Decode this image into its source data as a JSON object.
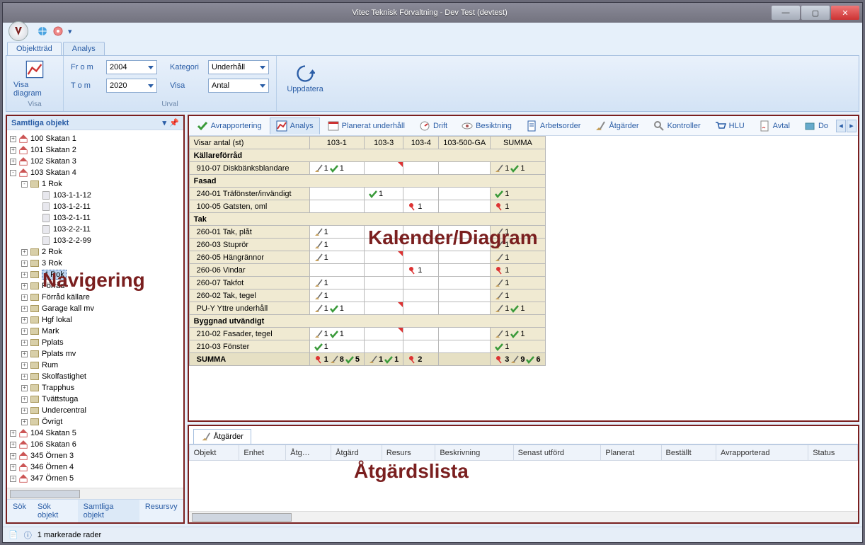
{
  "window": {
    "title": "Vitec Teknisk Förvaltning - Dev Test (devtest)"
  },
  "ribbon": {
    "tabs": {
      "objecttree": "Objektträd",
      "analys": "Analys"
    },
    "visa_diagram": "Visa diagram",
    "from_lbl": "Fr o m",
    "from_val": "2004",
    "to_lbl": "T o m",
    "to_val": "2020",
    "kategori_lbl": "Kategori",
    "kategori_val": "Underhåll",
    "visa_lbl": "Visa",
    "visa_val": "Antal",
    "uppdatera": "Uppdatera",
    "grp_visa": "Visa",
    "grp_urval": "Urval"
  },
  "nav": {
    "title": "Samtliga objekt",
    "items": [
      {
        "label": "100 Skatan 1",
        "icon": "house",
        "exp": "+"
      },
      {
        "label": "101 Skatan 2",
        "icon": "house",
        "exp": "+"
      },
      {
        "label": "102 Skatan 3",
        "icon": "house",
        "exp": "+"
      },
      {
        "label": "103 Skatan 4",
        "icon": "house",
        "exp": "-",
        "children": [
          {
            "label": "1 Rok",
            "icon": "folder",
            "exp": "-",
            "children": [
              {
                "label": "103-1-1-12",
                "icon": "leaf"
              },
              {
                "label": "103-1-2-11",
                "icon": "leaf"
              },
              {
                "label": "103-2-1-11",
                "icon": "leaf"
              },
              {
                "label": "103-2-2-11",
                "icon": "leaf"
              },
              {
                "label": "103-2-2-99",
                "icon": "leaf"
              }
            ]
          },
          {
            "label": "2 Rok",
            "icon": "folder",
            "exp": "+"
          },
          {
            "label": "3 Rok",
            "icon": "folder",
            "exp": "+"
          },
          {
            "label": "4 Rok",
            "icon": "folder",
            "exp": "+",
            "selected": true
          },
          {
            "label": "Förråd",
            "icon": "folder",
            "exp": "+"
          },
          {
            "label": "Förråd källare",
            "icon": "folder",
            "exp": "+"
          },
          {
            "label": "Garage kall mv",
            "icon": "folder",
            "exp": "+"
          },
          {
            "label": "Hgf lokal",
            "icon": "folder",
            "exp": "+"
          },
          {
            "label": "Mark",
            "icon": "folder",
            "exp": "+"
          },
          {
            "label": "Pplats",
            "icon": "folder",
            "exp": "+"
          },
          {
            "label": "Pplats mv",
            "icon": "folder",
            "exp": "+"
          },
          {
            "label": "Rum",
            "icon": "folder",
            "exp": "+"
          },
          {
            "label": "Skolfastighet",
            "icon": "folder",
            "exp": "+"
          },
          {
            "label": "Trapphus",
            "icon": "folder",
            "exp": "+"
          },
          {
            "label": "Tvättstuga",
            "icon": "folder",
            "exp": "+"
          },
          {
            "label": "Undercentral",
            "icon": "folder",
            "exp": "+"
          },
          {
            "label": "Övrigt",
            "icon": "folder",
            "exp": "+"
          }
        ]
      },
      {
        "label": "104 Skatan 5",
        "icon": "house",
        "exp": "+"
      },
      {
        "label": "106 Skatan 6",
        "icon": "house",
        "exp": "+"
      },
      {
        "label": "345 Örnen 3",
        "icon": "house",
        "exp": "+"
      },
      {
        "label": "346 Örnen 4",
        "icon": "house",
        "exp": "+"
      },
      {
        "label": "347 Örnen 5",
        "icon": "house",
        "exp": "+"
      }
    ],
    "bottom_tabs": {
      "sok": "Sök",
      "sokobj": "Sök objekt",
      "samtliga": "Samtliga objekt",
      "resursvy": "Resursvy"
    }
  },
  "tabs": {
    "avrapp": "Avrapportering",
    "analys": "Analys",
    "planerat": "Planerat underhåll",
    "drift": "Drift",
    "besikt": "Besiktning",
    "arbets": "Arbetsorder",
    "atgard": "Åtgärder",
    "kontroll": "Kontroller",
    "hlu": "HLU",
    "avtal": "Avtal",
    "dok": "Do"
  },
  "grid": {
    "corner": "Visar antal (st)",
    "cols": [
      "103-1",
      "103-3",
      "103-4",
      "103-500-GA",
      "SUMMA"
    ],
    "groups": [
      {
        "name": "Källareförråd",
        "rows": [
          {
            "name": "910-07 Diskbänksblandare",
            "cells": [
              "b1c1",
              "",
              "",
              "",
              "b1c1"
            ],
            "flag": [
              false,
              true,
              false,
              false,
              false
            ]
          }
        ]
      },
      {
        "name": "Fasad",
        "rows": [
          {
            "name": "240-01 Träfönster/invändigt",
            "cells": [
              "",
              "c1",
              "",
              "",
              "c1"
            ]
          },
          {
            "name": "100-05 Gatsten, oml",
            "cells": [
              "",
              "",
              "p1",
              "",
              "p1"
            ]
          }
        ]
      },
      {
        "name": "Tak",
        "rows": [
          {
            "name": "260-01 Tak, plåt",
            "cells": [
              "b1",
              "",
              "",
              "",
              "b1"
            ]
          },
          {
            "name": "260-03 Stuprör",
            "cells": [
              "b1",
              "",
              "",
              "",
              "b1"
            ],
            "flag": [
              false,
              true,
              false,
              false,
              false
            ]
          },
          {
            "name": "260-05 Hängrännor",
            "cells": [
              "b1",
              "",
              "",
              "",
              "b1"
            ],
            "flag": [
              false,
              true,
              false,
              false,
              false
            ]
          },
          {
            "name": "260-06 Vindar",
            "cells": [
              "",
              "",
              "p1",
              "",
              "p1"
            ]
          },
          {
            "name": "260-07 Takfot",
            "cells": [
              "b1",
              "",
              "",
              "",
              "b1"
            ]
          },
          {
            "name": "260-02 Tak, tegel",
            "cells": [
              "b1",
              "",
              "",
              "",
              "b1"
            ]
          },
          {
            "name": "PU-Y Yttre underhåll",
            "cells": [
              "b1c1",
              "",
              "",
              "",
              "b1c1"
            ],
            "flag": [
              false,
              true,
              false,
              false,
              false
            ]
          }
        ]
      },
      {
        "name": "Byggnad utvändigt",
        "rows": [
          {
            "name": "210-02 Fasader, tegel",
            "cells": [
              "b1c1",
              "",
              "",
              "",
              "b1c1"
            ],
            "flag": [
              false,
              true,
              false,
              false,
              false
            ]
          },
          {
            "name": "210-03 Fönster",
            "cells": [
              "c1",
              "",
              "",
              "",
              "c1"
            ]
          }
        ]
      }
    ],
    "summa": {
      "name": "SUMMA",
      "cells": [
        "p1b8c5",
        "b1c1",
        "p2",
        "",
        "p3b9c6"
      ]
    }
  },
  "actions": {
    "tab": "Åtgärder",
    "cols": [
      "Objekt",
      "Enhet",
      "Åtg…",
      "Åtgärd",
      "Resurs",
      "Beskrivning",
      "Senast utförd",
      "Planerat",
      "Beställt",
      "Avrapporterad",
      "Status"
    ]
  },
  "status": {
    "text": "1 markerade rader"
  },
  "overlays": {
    "nav": "Navigering",
    "cal": "Kalender/Diagram",
    "act": "Åtgärdslista"
  }
}
